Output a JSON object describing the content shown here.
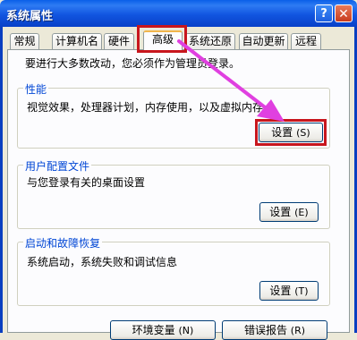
{
  "window": {
    "title": "系统属性"
  },
  "titlebar": {
    "help_label": "?",
    "close_label": "✕"
  },
  "tabs": [
    {
      "label": "常规"
    },
    {
      "label": "计算机名"
    },
    {
      "label": "硬件"
    },
    {
      "label": "高级",
      "active": true
    },
    {
      "label": "系统还原"
    },
    {
      "label": "自动更新"
    },
    {
      "label": "远程"
    }
  ],
  "panel": {
    "message": "要进行大多数改动，您必须作为管理员登录。"
  },
  "groups": {
    "performance": {
      "title": "性能",
      "description": "视觉效果，处理器计划，内存使用，以及虚拟内存",
      "button_label": "设置",
      "button_key": "(S)"
    },
    "user_profiles": {
      "title": "用户配置文件",
      "description": "与您登录有关的桌面设置",
      "button_label": "设置",
      "button_key": "(E)"
    },
    "startup_recovery": {
      "title": "启动和故障恢复",
      "description": "系统启动，系统失败和调试信息",
      "button_label": "设置",
      "button_key": "(T)"
    }
  },
  "bottom_buttons": {
    "env_label": "环境变量",
    "env_key": "(N)",
    "error_label": "错误报告",
    "error_key": "(R)"
  },
  "colors": {
    "title_bar": "#0A5FE8",
    "dialog_bg": "#ECE9D8",
    "annotation": "#C8161D",
    "arrow": "#E040E0",
    "group_title": "#0046D5"
  }
}
